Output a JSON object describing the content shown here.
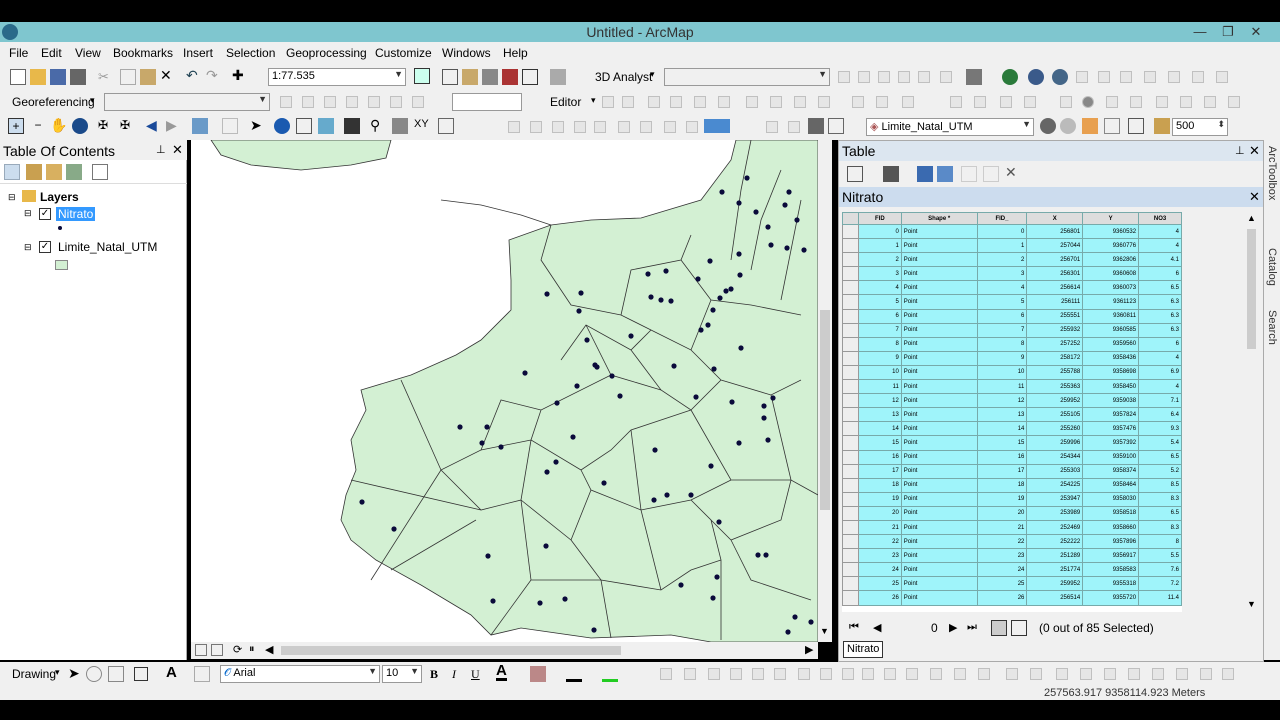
{
  "app": {
    "title": "Untitled - ArcMap"
  },
  "menu": [
    "File",
    "Edit",
    "View",
    "Bookmarks",
    "Insert",
    "Selection",
    "Geoprocessing",
    "Customize",
    "Windows",
    "Help"
  ],
  "toolbar": {
    "scale": "1:77.535",
    "analyst_label": "3D Analyst",
    "georef_label": "Georeferencing",
    "editor_label": "Editor",
    "layer_select": "Limite_Natal_UTM",
    "zoom_value": "500"
  },
  "toc": {
    "title": "Table Of Contents",
    "root": "Layers",
    "layers": [
      {
        "name": "Nitrato"
      },
      {
        "name": "Limite_Natal_UTM"
      }
    ]
  },
  "table_window": {
    "title": "Table",
    "tab_title": "Nitrato",
    "tab_label": "Nitrato",
    "record_index": "0",
    "selection_status": "(0 out of 85 Selected)"
  },
  "attribute_table": {
    "columns": [
      "FID",
      "Shape *",
      "FID_",
      "X",
      "Y",
      "NO3"
    ],
    "rows": [
      [
        "0",
        "Point",
        "0",
        "256801",
        "9360532",
        "4"
      ],
      [
        "1",
        "Point",
        "1",
        "257044",
        "9360776",
        "4"
      ],
      [
        "2",
        "Point",
        "2",
        "256701",
        "9362806",
        "4.1"
      ],
      [
        "3",
        "Point",
        "3",
        "256301",
        "9360608",
        "6"
      ],
      [
        "4",
        "Point",
        "4",
        "256614",
        "9360073",
        "6.5"
      ],
      [
        "5",
        "Point",
        "5",
        "256111",
        "9361123",
        "6.3"
      ],
      [
        "6",
        "Point",
        "6",
        "255551",
        "9360811",
        "6.3"
      ],
      [
        "7",
        "Point",
        "7",
        "255932",
        "9360585",
        "6.3"
      ],
      [
        "8",
        "Point",
        "8",
        "257252",
        "9359560",
        "6"
      ],
      [
        "9",
        "Point",
        "9",
        "258172",
        "9358436",
        "4"
      ],
      [
        "10",
        "Point",
        "10",
        "255788",
        "9358698",
        "6.9"
      ],
      [
        "11",
        "Point",
        "11",
        "255363",
        "9358450",
        "4"
      ],
      [
        "12",
        "Point",
        "12",
        "259952",
        "9359038",
        "7.1"
      ],
      [
        "13",
        "Point",
        "13",
        "255105",
        "9357824",
        "6.4"
      ],
      [
        "14",
        "Point",
        "14",
        "255260",
        "9357476",
        "9.3"
      ],
      [
        "15",
        "Point",
        "15",
        "259996",
        "9357392",
        "5.4"
      ],
      [
        "16",
        "Point",
        "16",
        "254344",
        "9359100",
        "6.5"
      ],
      [
        "17",
        "Point",
        "17",
        "255303",
        "9358374",
        "5.2"
      ],
      [
        "18",
        "Point",
        "18",
        "254225",
        "9358464",
        "8.5"
      ],
      [
        "19",
        "Point",
        "19",
        "253947",
        "9358030",
        "8.3"
      ],
      [
        "20",
        "Point",
        "20",
        "253989",
        "9358518",
        "6.5"
      ],
      [
        "21",
        "Point",
        "21",
        "252469",
        "9358660",
        "8.3"
      ],
      [
        "22",
        "Point",
        "22",
        "252222",
        "9357896",
        "8"
      ],
      [
        "23",
        "Point",
        "23",
        "251289",
        "9356917",
        "5.5"
      ],
      [
        "24",
        "Point",
        "24",
        "251774",
        "9358583",
        "7.6"
      ],
      [
        "25",
        "Point",
        "25",
        "259952",
        "9355318",
        "7.2"
      ],
      [
        "26",
        "Point",
        "26",
        "256514",
        "9355720",
        "11.4"
      ]
    ]
  },
  "drawing": {
    "label": "Drawing",
    "font_name": "Arial",
    "font_size": "10"
  },
  "status": {
    "coordinates": "257563.917 9358114.923 Meters"
  },
  "side_tabs": [
    "ArcToolbox",
    "Catalog",
    "Search"
  ],
  "colors": {
    "title_bar": "#7fc6cf",
    "polygon_fill": "#d3f0d3",
    "table_cell": "#9ff4fa",
    "point": "#0a0a3a"
  }
}
